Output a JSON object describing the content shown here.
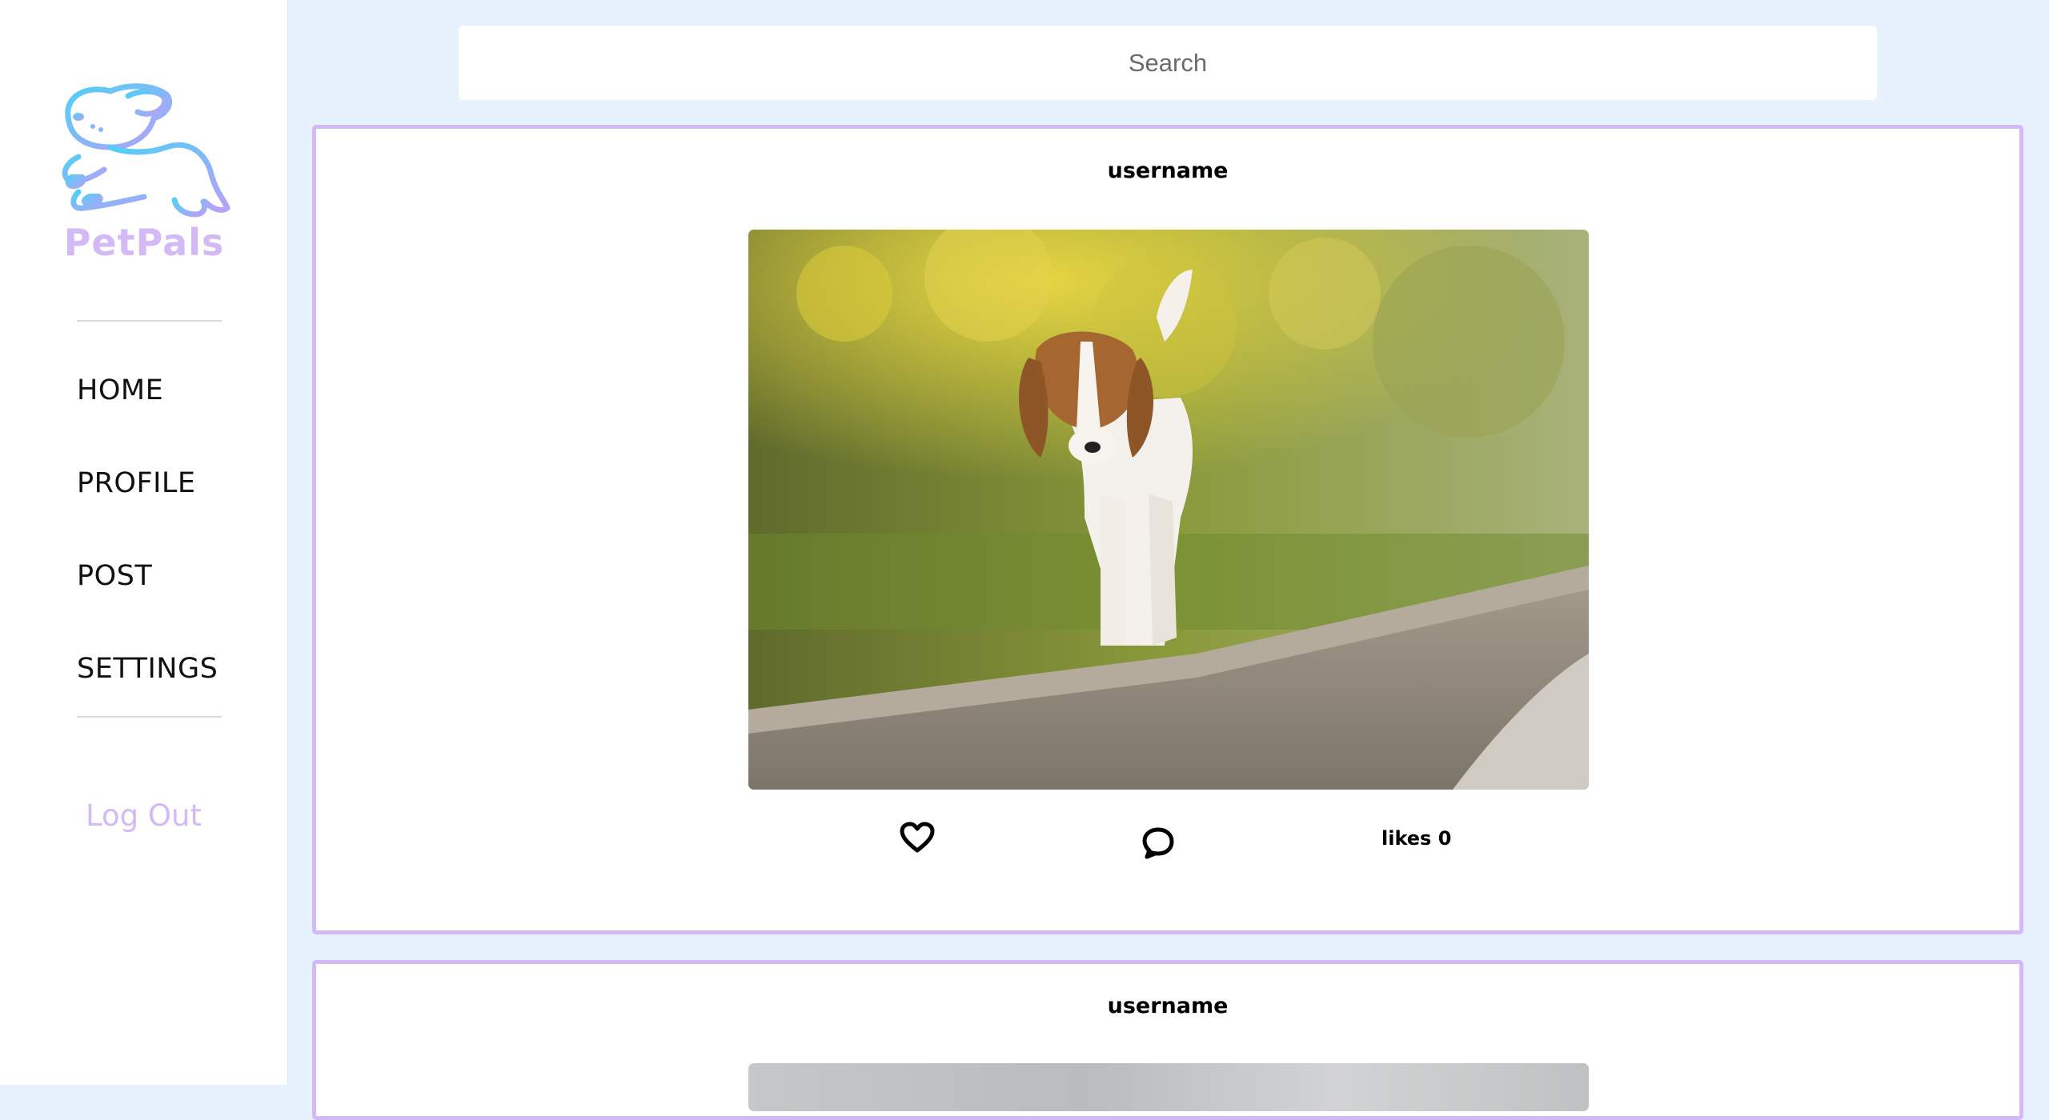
{
  "app": {
    "brand": "PetPals"
  },
  "sidebar": {
    "nav": [
      {
        "label": "HOME"
      },
      {
        "label": "PROFILE"
      },
      {
        "label": "POST"
      },
      {
        "label": "SETTINGS"
      }
    ],
    "logout_label": "Log Out"
  },
  "search": {
    "placeholder": "Search",
    "value": ""
  },
  "posts": [
    {
      "username": "username",
      "likes_text": "likes 0",
      "image": "beagle-photo"
    },
    {
      "username": "username",
      "image": "grey-photo"
    }
  ],
  "colors": {
    "accent": "#d3b9f6",
    "background": "#e8f2fd",
    "logo_blue": "#56c8f5"
  },
  "icons": {
    "like": "heart-icon",
    "comment": "comment-bubble-icon"
  }
}
